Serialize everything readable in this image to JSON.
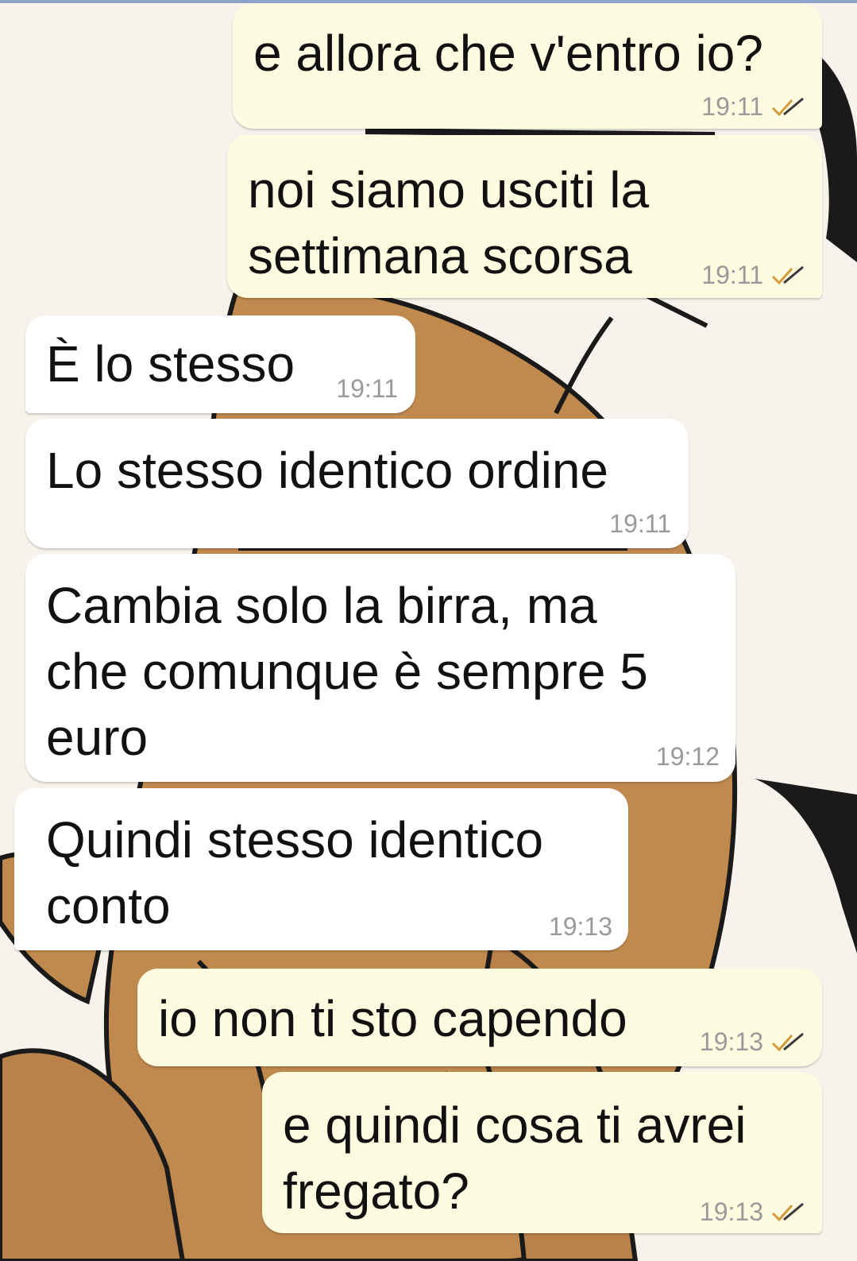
{
  "chat": {
    "messages": [
      {
        "direction": "outgoing",
        "text": "e allora che v'entro io?",
        "time": "19:11",
        "status": "read-ticks-icon"
      },
      {
        "direction": "outgoing",
        "text": "noi siamo usciti la\nsettimana scorsa",
        "time": "19:11",
        "status": "read-ticks-icon"
      },
      {
        "direction": "incoming",
        "text": "È lo stesso",
        "time": "19:11"
      },
      {
        "direction": "incoming",
        "text": "Lo stesso identico ordine",
        "time": "19:11"
      },
      {
        "direction": "incoming",
        "text": "Cambia solo la birra, ma\nche comunque è sempre 5\neuro",
        "time": "19:12"
      },
      {
        "direction": "incoming",
        "text": "Quindi stesso identico\nconto",
        "time": "19:13"
      },
      {
        "direction": "outgoing",
        "text": "io non ti sto capendo",
        "time": "19:13",
        "status": "read-ticks-icon"
      },
      {
        "direction": "outgoing",
        "text": "e quindi cosa ti avrei\nfregato?",
        "time": "19:13",
        "status": "read-ticks-icon"
      }
    ]
  },
  "colors": {
    "outgoing_bubble": "#fdfbe0",
    "incoming_bubble": "#ffffff",
    "timestamp": "#9a9a9a",
    "ticks": "#d29a3a",
    "wallpaper_skin": "#c08a4f",
    "wallpaper_outline": "#1a1a1a"
  }
}
